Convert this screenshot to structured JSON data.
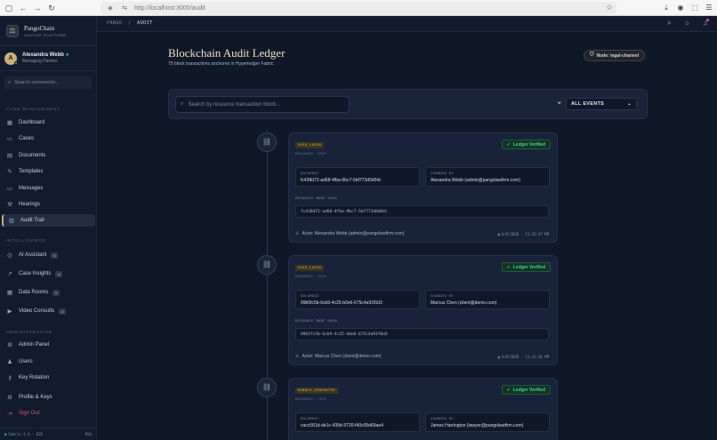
{
  "browser": {
    "url": "http://localhost:3000/audit"
  },
  "brand": {
    "name": "PangoChain",
    "subtitle": "JUSTICE PLATFORM"
  },
  "user": {
    "initial": "A",
    "name": "Alexandra Webb",
    "role": "Managing Partner"
  },
  "sidebar": {
    "search_placeholder": "Search commands...",
    "section_case": "CASE MANAGEMENT",
    "section_intel": "INTELLIGENCE",
    "section_admin": "ADMINISTRATION",
    "ai_badge": "AI",
    "items": [
      {
        "label": "Dashboard"
      },
      {
        "label": "Cases"
      },
      {
        "label": "Documents"
      },
      {
        "label": "Templates"
      },
      {
        "label": "Messages"
      },
      {
        "label": "Hearings"
      },
      {
        "label": "Audit Trail"
      },
      {
        "label": "AI Assistant"
      },
      {
        "label": "Case Insights"
      },
      {
        "label": "Data Rooms"
      },
      {
        "label": "Video Consults"
      },
      {
        "label": "Admin Panel"
      },
      {
        "label": "Users"
      },
      {
        "label": "Key Rotation"
      },
      {
        "label": "Profile & Keys"
      },
      {
        "label": "Sign Out"
      }
    ],
    "footer_left": "Fabric 2.4 · E2E",
    "footer_right": "RSA"
  },
  "topbar": {
    "crumb_root": "PANGO",
    "crumb_sep": "/",
    "crumb_current": "AUDIT"
  },
  "page": {
    "title": "Blockchain Audit Ledger",
    "subtitle": "75 block transactions anchored in Hyperledger Fabric.",
    "node_badge": "Node: legal-channel"
  },
  "filter": {
    "search_placeholder": "Search by resource transaction block...",
    "select_value": "ALL EVENTS"
  },
  "labels": {
    "document": "DOCUMENT",
    "changed_by": "CHANGED BY",
    "hash": "RESOURCE NODE HASH",
    "actor_prefix": "Actor:",
    "verified": "Ledger Verified"
  },
  "events": [
    {
      "type": "USER_LOGIN",
      "resource": "RESOURCE: USER",
      "document": "fc438d72-ad68-4fba-9bc7-5bf773d0d04c",
      "changed_by": "Alexandra Webb (admin@pangolawfirm.com)",
      "hash": "fc438d72-ad68-4fba-9bc7-5bf773d0d04c",
      "actor": "Alexandra Webb (admin@pangolawfirm.com)",
      "timestamp": "6/9/2026 · 11:33:47 PM"
    },
    {
      "type": "USER_LOGIN",
      "resource": "RESOURCE: USER",
      "document": "99b5fc5b-6cb9-4c25-b0e6-675c4a91f0d3",
      "changed_by": "Marcus Chen (client@demo.com)",
      "hash": "99b5fc5b-6cb9-4c25-b0e6-675c4a91f0d3",
      "actor": "Marcus Chen (client@demo.com)",
      "timestamp": "6/9/2026 · 11:31:30 PM"
    },
    {
      "type": "BUNDLE_GENERATED",
      "resource": "RESOURCE: CASE",
      "document": "cacc581d-de1c-439d-9730-f40c05d69ae4",
      "changed_by": "James Harrington (lawyer@pangolawfirm.com)"
    }
  ],
  "colors": {
    "accent_gold": "#c9b07a",
    "verified_green": "#3fd68a",
    "signout_red": "#e0556b",
    "background": "#0f1829"
  }
}
